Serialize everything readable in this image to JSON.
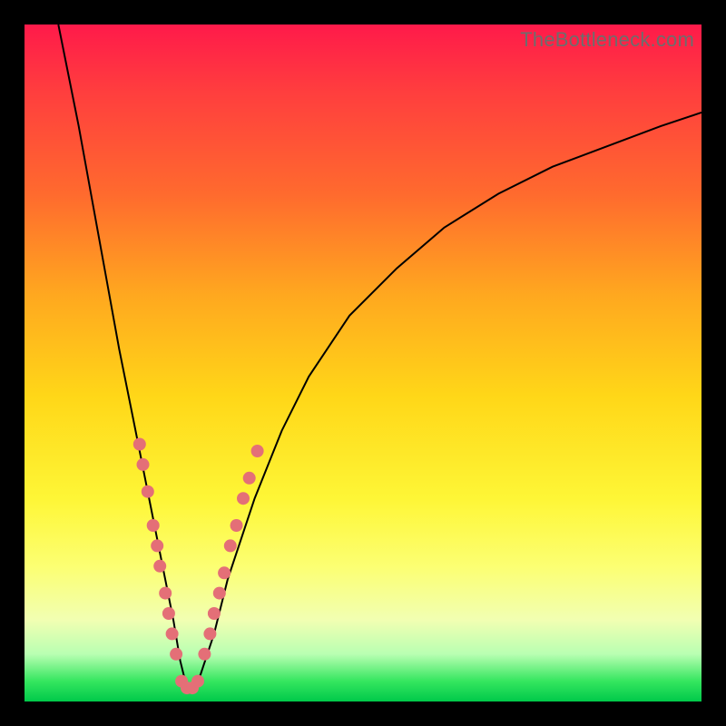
{
  "watermark": "TheBottleneck.com",
  "colors": {
    "frame": "#000000",
    "curve": "#000000",
    "dot": "#e46f77",
    "gradient_top": "#ff1a4a",
    "gradient_bottom": "#00c94a"
  },
  "chart_data": {
    "type": "line",
    "title": "",
    "xlabel": "",
    "ylabel": "",
    "xlim": [
      0,
      100
    ],
    "ylim": [
      0,
      100
    ],
    "description": "Bottleneck percentage curve with minimum near x≈24; y-axis is inverted visually (lower value at bottom = good/green).",
    "series": [
      {
        "name": "bottleneck-curve",
        "x": [
          5,
          8,
          10,
          12,
          14,
          16,
          18,
          20,
          22,
          23,
          24,
          25,
          26,
          28,
          30,
          34,
          38,
          42,
          48,
          55,
          62,
          70,
          78,
          86,
          94,
          100
        ],
        "y": [
          100,
          85,
          74,
          63,
          52,
          42,
          32,
          22,
          12,
          6,
          2,
          2,
          4,
          10,
          18,
          30,
          40,
          48,
          57,
          64,
          70,
          75,
          79,
          82,
          85,
          87
        ]
      }
    ],
    "marker_clusters": [
      {
        "name": "left-cluster",
        "points": [
          {
            "x": 17.0,
            "y": 38
          },
          {
            "x": 17.5,
            "y": 35
          },
          {
            "x": 18.2,
            "y": 31
          },
          {
            "x": 19.0,
            "y": 26
          },
          {
            "x": 19.6,
            "y": 23
          },
          {
            "x": 20.0,
            "y": 20
          },
          {
            "x": 20.8,
            "y": 16
          },
          {
            "x": 21.3,
            "y": 13
          },
          {
            "x": 21.8,
            "y": 10
          },
          {
            "x": 22.4,
            "y": 7
          }
        ]
      },
      {
        "name": "bottom-cluster",
        "points": [
          {
            "x": 23.2,
            "y": 3
          },
          {
            "x": 24.0,
            "y": 2
          },
          {
            "x": 24.8,
            "y": 2
          },
          {
            "x": 25.6,
            "y": 3
          }
        ]
      },
      {
        "name": "right-cluster",
        "points": [
          {
            "x": 26.6,
            "y": 7
          },
          {
            "x": 27.4,
            "y": 10
          },
          {
            "x": 28.0,
            "y": 13
          },
          {
            "x": 28.8,
            "y": 16
          },
          {
            "x": 29.5,
            "y": 19
          },
          {
            "x": 30.4,
            "y": 23
          },
          {
            "x": 31.3,
            "y": 26
          },
          {
            "x": 32.3,
            "y": 30
          },
          {
            "x": 33.2,
            "y": 33
          },
          {
            "x": 34.4,
            "y": 37
          }
        ]
      }
    ]
  }
}
